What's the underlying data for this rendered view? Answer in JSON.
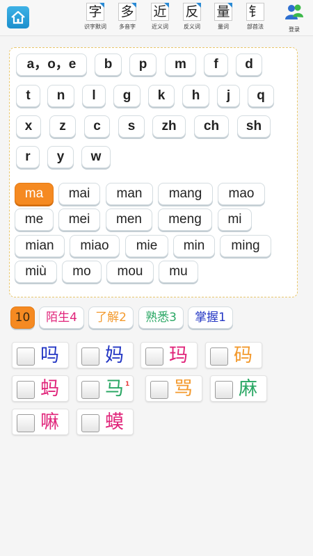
{
  "toolbar": {
    "home_icon": "home-icon",
    "tools": [
      {
        "glyph": "字",
        "label": "识字默词"
      },
      {
        "glyph": "多",
        "label": "多音字"
      },
      {
        "glyph": "近",
        "label": "近义词"
      },
      {
        "glyph": "反",
        "label": "反义词"
      },
      {
        "glyph": "量",
        "label": "量词"
      },
      {
        "glyph": "钅",
        "label": "部首法"
      }
    ],
    "login_label": "登录"
  },
  "pinyin_keys": {
    "initials": [
      "a，o，e",
      "b",
      "p",
      "m",
      "f",
      "d",
      "t",
      "n",
      "l",
      "g",
      "k",
      "h",
      "j",
      "q",
      "x",
      "z",
      "c",
      "s",
      "zh",
      "ch",
      "sh",
      "r",
      "y",
      "w"
    ],
    "syllables": [
      "ma",
      "mai",
      "man",
      "mang",
      "mao",
      "me",
      "mei",
      "men",
      "meng",
      "mi",
      "mian",
      "miao",
      "mie",
      "min",
      "ming",
      "miù",
      "mo",
      "mou",
      "mu"
    ],
    "selected": "ma"
  },
  "filters": {
    "count": "10",
    "items": [
      {
        "label": "陌生4",
        "color": "#e0247a"
      },
      {
        "label": "了解2",
        "color": "#f39a2e"
      },
      {
        "label": "熟悉3",
        "color": "#2aa764"
      },
      {
        "label": "掌握1",
        "color": "#2437c4"
      }
    ]
  },
  "characters": [
    {
      "char": "吗",
      "color": "#2437c4"
    },
    {
      "char": "妈",
      "color": "#2437c4"
    },
    {
      "char": "玛",
      "color": "#e0247a"
    },
    {
      "char": "码",
      "color": "#f39a2e"
    },
    {
      "char": "蚂",
      "color": "#e0247a"
    },
    {
      "char": "马",
      "color": "#2aa764",
      "superscript": "1"
    },
    {
      "char": "骂",
      "color": "#f39a2e"
    },
    {
      "char": "麻",
      "color": "#2aa764"
    },
    {
      "char": "嘛",
      "color": "#e0247a"
    },
    {
      "char": "蟆",
      "color": "#e0247a"
    }
  ]
}
